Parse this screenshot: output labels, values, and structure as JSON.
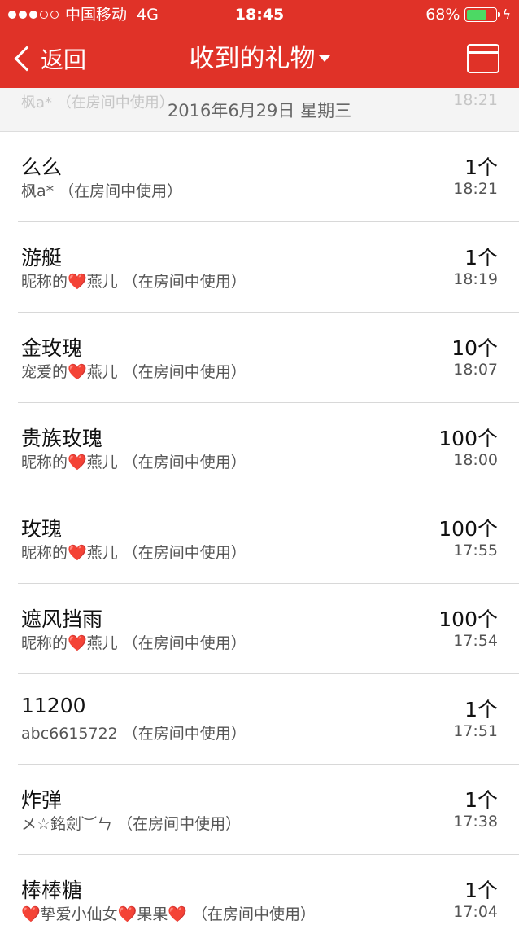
{
  "status_bar": {
    "carrier": "中国移动",
    "network": "4G",
    "time": "18:45",
    "battery": "68%",
    "battery_level": 0.68
  },
  "nav": {
    "back_label": "返回",
    "title": "收到的礼物",
    "icons": [
      "chevron-left-icon",
      "caret-down-icon",
      "calendar-icon"
    ]
  },
  "date_header": {
    "date": "2016年6月29日 星期三",
    "ghost_sender": "枫a*  （在房间中使用）",
    "ghost_time": "18:21"
  },
  "gifts": [
    {
      "name": "么么",
      "sender": "枫a*  （在房间中使用）",
      "count": "1个",
      "time": "18:21"
    },
    {
      "name": "游艇",
      "sender": "昵称的❤️燕儿  （在房间中使用）",
      "count": "1个",
      "time": "18:19"
    },
    {
      "name": "金玫瑰",
      "sender": "宠爱的❤️燕儿  （在房间中使用）",
      "count": "10个",
      "time": "18:07"
    },
    {
      "name": "贵族玫瑰",
      "sender": "昵称的❤️燕儿  （在房间中使用）",
      "count": "100个",
      "time": "18:00"
    },
    {
      "name": "玫瑰",
      "sender": "昵称的❤️燕儿  （在房间中使用）",
      "count": "100个",
      "time": "17:55"
    },
    {
      "name": "遮风挡雨",
      "sender": "昵称的❤️燕儿  （在房间中使用）",
      "count": "100个",
      "time": "17:54"
    },
    {
      "name": "11200",
      "sender": "abc6615722  （在房间中使用）",
      "count": "1个",
      "time": "17:51"
    },
    {
      "name": "炸弹",
      "sender": "メ☆銘劍︶ㄣ  （在房间中使用）",
      "count": "1个",
      "time": "17:38"
    },
    {
      "name": "棒棒糖",
      "sender": "❤️挚爱小仙女❤️果果❤️  （在房间中使用）",
      "count": "1个",
      "time": "17:04"
    }
  ],
  "colors": {
    "header_red": "#e03228",
    "battery_green": "#4cd964"
  }
}
